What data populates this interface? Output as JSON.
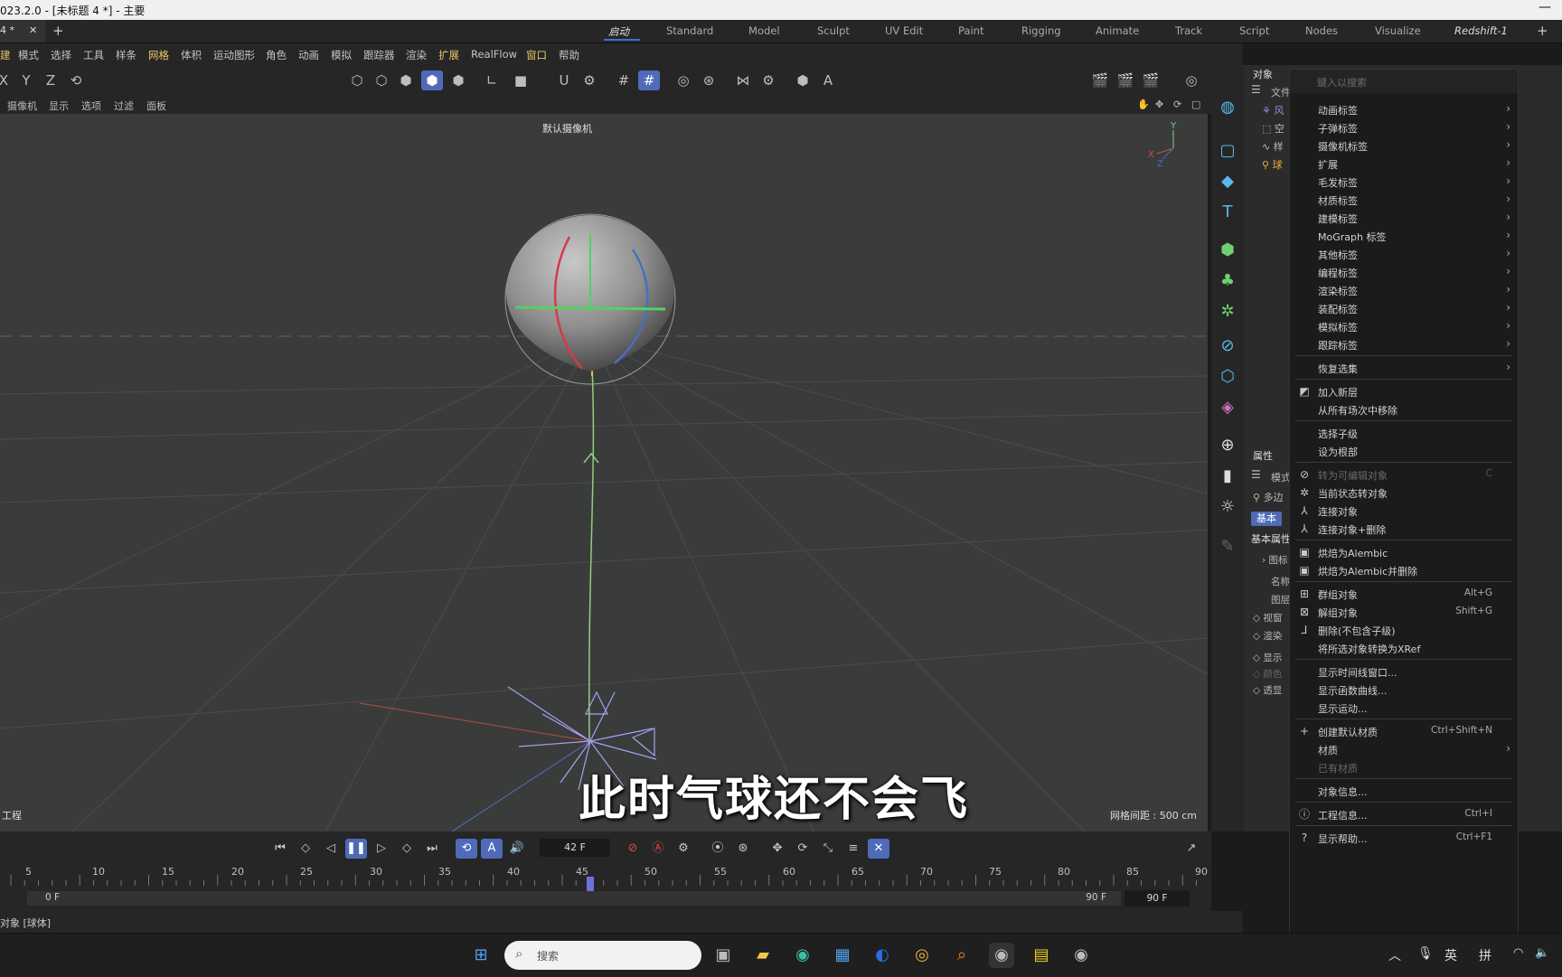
{
  "window": {
    "title": "023.2.0 - [未标题 4 *] - 主要",
    "doc_tab": "4 *",
    "layout_tabs": [
      "启动",
      "Standard",
      "Model",
      "Sculpt",
      "UV Edit",
      "Paint",
      "Rigging",
      "Animate",
      "Track",
      "Script",
      "Nodes",
      "Visualize",
      "Redshift-1"
    ],
    "active_layout": "启动"
  },
  "menubar": [
    "建",
    "模式",
    "选择",
    "工具",
    "样条",
    "网格",
    "体积",
    "运动图形",
    "角色",
    "动画",
    "模拟",
    "跟踪器",
    "渲染",
    "扩展",
    "RealFlow",
    "窗口",
    "帮助"
  ],
  "axes": [
    "X",
    "Y",
    "Z"
  ],
  "viewport": {
    "menu": [
      "摄像机",
      "显示",
      "选项",
      "过滤",
      "面板"
    ],
    "camera_label": "默认摄像机",
    "grid_info": "网格间距 : 500 cm",
    "project_label": "工程",
    "subtitle": "此时气球还不会飞"
  },
  "object_manager": {
    "title": "对象",
    "file_menu": "文件",
    "objects": [
      "风",
      "空",
      "样",
      "球"
    ]
  },
  "attributes": {
    "title": "属性",
    "mode": "模式",
    "object_type": "多边",
    "tab_basic": "基本",
    "section": "基本属性",
    "rows": [
      "图标",
      "名称",
      "图层",
      "视窗",
      "渲染",
      "显示",
      "颜色",
      "透显"
    ]
  },
  "timeline": {
    "current_frame": "42 F",
    "current_value": 42,
    "ticks": [
      "5",
      "10",
      "15",
      "20",
      "25",
      "30",
      "35",
      "40",
      "45",
      "50",
      "55",
      "60",
      "65",
      "70",
      "75",
      "80",
      "85",
      "90"
    ],
    "range_start": "0 F",
    "range_end": "90 F",
    "end_frame": "90 F"
  },
  "status": "对象 [球体]",
  "context_menu": {
    "search_placeholder": "键入以搜索",
    "items": [
      {
        "label": "动画标签",
        "submenu": true
      },
      {
        "label": "子弹标签",
        "submenu": true
      },
      {
        "label": "摄像机标签",
        "submenu": true
      },
      {
        "label": "扩展",
        "submenu": true
      },
      {
        "label": "毛发标签",
        "submenu": true
      },
      {
        "label": "材质标签",
        "submenu": true
      },
      {
        "label": "建模标签",
        "submenu": true
      },
      {
        "label": "MoGraph 标签",
        "submenu": true
      },
      {
        "label": "其他标签",
        "submenu": true
      },
      {
        "label": "编程标签",
        "submenu": true
      },
      {
        "label": "渲染标签",
        "submenu": true
      },
      {
        "label": "装配标签",
        "submenu": true
      },
      {
        "label": "模拟标签",
        "submenu": true
      },
      {
        "label": "跟踪标签",
        "submenu": true
      },
      {
        "label": "恢复选集",
        "submenu": true
      },
      {
        "label": "加入新层"
      },
      {
        "label": "从所有场次中移除"
      },
      {
        "label": "选择子级"
      },
      {
        "label": "设为根部"
      },
      {
        "label": "转为可编辑对象",
        "shortcut": "C",
        "disabled": true
      },
      {
        "label": "当前状态转对象"
      },
      {
        "label": "连接对象"
      },
      {
        "label": "连接对象+删除"
      },
      {
        "label": "烘焙为Alembic"
      },
      {
        "label": "烘焙为Alembic并删除"
      },
      {
        "label": "群组对象",
        "shortcut": "Alt+G"
      },
      {
        "label": "解组对象",
        "shortcut": "Shift+G"
      },
      {
        "label": "删除(不包含子级)"
      },
      {
        "label": "将所选对象转换为XRef"
      },
      {
        "label": "显示时间线窗口..."
      },
      {
        "label": "显示函数曲线..."
      },
      {
        "label": "显示运动..."
      },
      {
        "label": "创建默认材质",
        "shortcut": "Ctrl+Shift+N"
      },
      {
        "label": "材质",
        "submenu": true
      },
      {
        "label": "已有材质",
        "disabled": true
      },
      {
        "label": "对象信息..."
      },
      {
        "label": "工程信息...",
        "shortcut": "Ctrl+I"
      },
      {
        "label": "显示帮助...",
        "shortcut": "Ctrl+F1"
      }
    ]
  },
  "taskbar": {
    "search_placeholder": "搜索",
    "ime": [
      "英",
      "拼"
    ]
  },
  "colors": {
    "accent": "#4f6bb8",
    "panel_bg": "#262626",
    "viewport_bg": "#3a3c3b",
    "menu_highlight": "#e8c66a"
  }
}
